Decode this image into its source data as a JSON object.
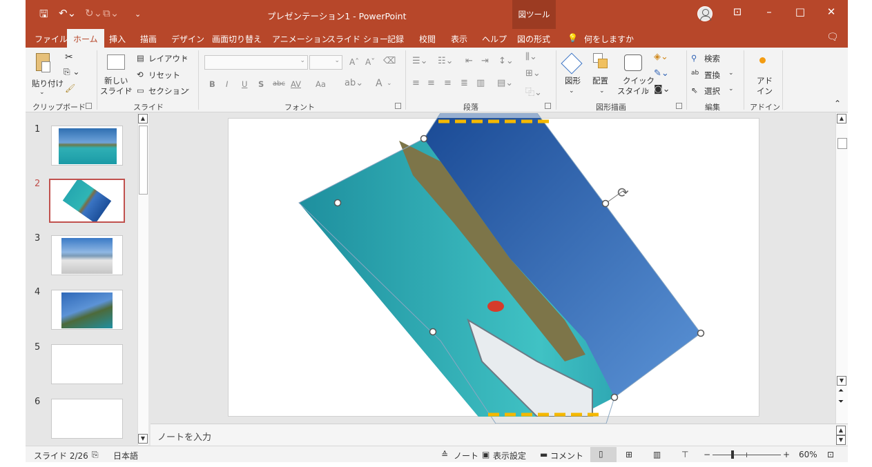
{
  "titlebar": {
    "title": "プレゼンテーション1 - PowerPoint",
    "picture_tools": "図ツール"
  },
  "tabs": [
    "ファイル",
    "ホーム",
    "挿入",
    "描画",
    "デザイン",
    "画面切り替え",
    "アニメーション",
    "スライド ショー",
    "記録",
    "校閲",
    "表示",
    "ヘルプ",
    "図の形式"
  ],
  "tell_me": "何をしますか",
  "ribbon": {
    "clipboard": {
      "paste": "貼り付け",
      "label": "クリップボード"
    },
    "slides": {
      "new_slide_1": "新しい",
      "new_slide_2": "スライド",
      "layout": "レイアウト",
      "reset": "リセット",
      "section": "セクション",
      "label": "スライド"
    },
    "font": {
      "bold": "B",
      "italic": "I",
      "underline": "U",
      "shadow": "S",
      "strike": "abc",
      "spacing": "AV",
      "case": "Aa",
      "color_a": "A",
      "label": "フォント"
    },
    "paragraph": {
      "label": "段落"
    },
    "drawing": {
      "shapes": "図形",
      "arrange": "配置",
      "quick_1": "クイック",
      "quick_2": "スタイル",
      "label": "図形描画"
    },
    "editing": {
      "find": "検索",
      "replace": "置換",
      "select": "選択",
      "label": "編集"
    },
    "addins": {
      "addin_1": "アド",
      "addin_2": "イン",
      "label": "アドイン"
    }
  },
  "slides": [
    {
      "num": "1"
    },
    {
      "num": "2"
    },
    {
      "num": "3"
    },
    {
      "num": "4"
    },
    {
      "num": "5"
    },
    {
      "num": "6"
    }
  ],
  "selected_slide": 2,
  "notes_placeholder": "ノートを入力",
  "statusbar": {
    "slide_info": "スライド 2/26",
    "language": "日本語",
    "notes": "ノート",
    "display_settings": "表示設定",
    "comments": "コメント",
    "zoom_minus": "−",
    "zoom_plus": "+",
    "zoom": "60%"
  },
  "colors": {
    "brand": "#b7472a",
    "selection": "#c0504d",
    "highlight_dash": "#f5b800"
  }
}
